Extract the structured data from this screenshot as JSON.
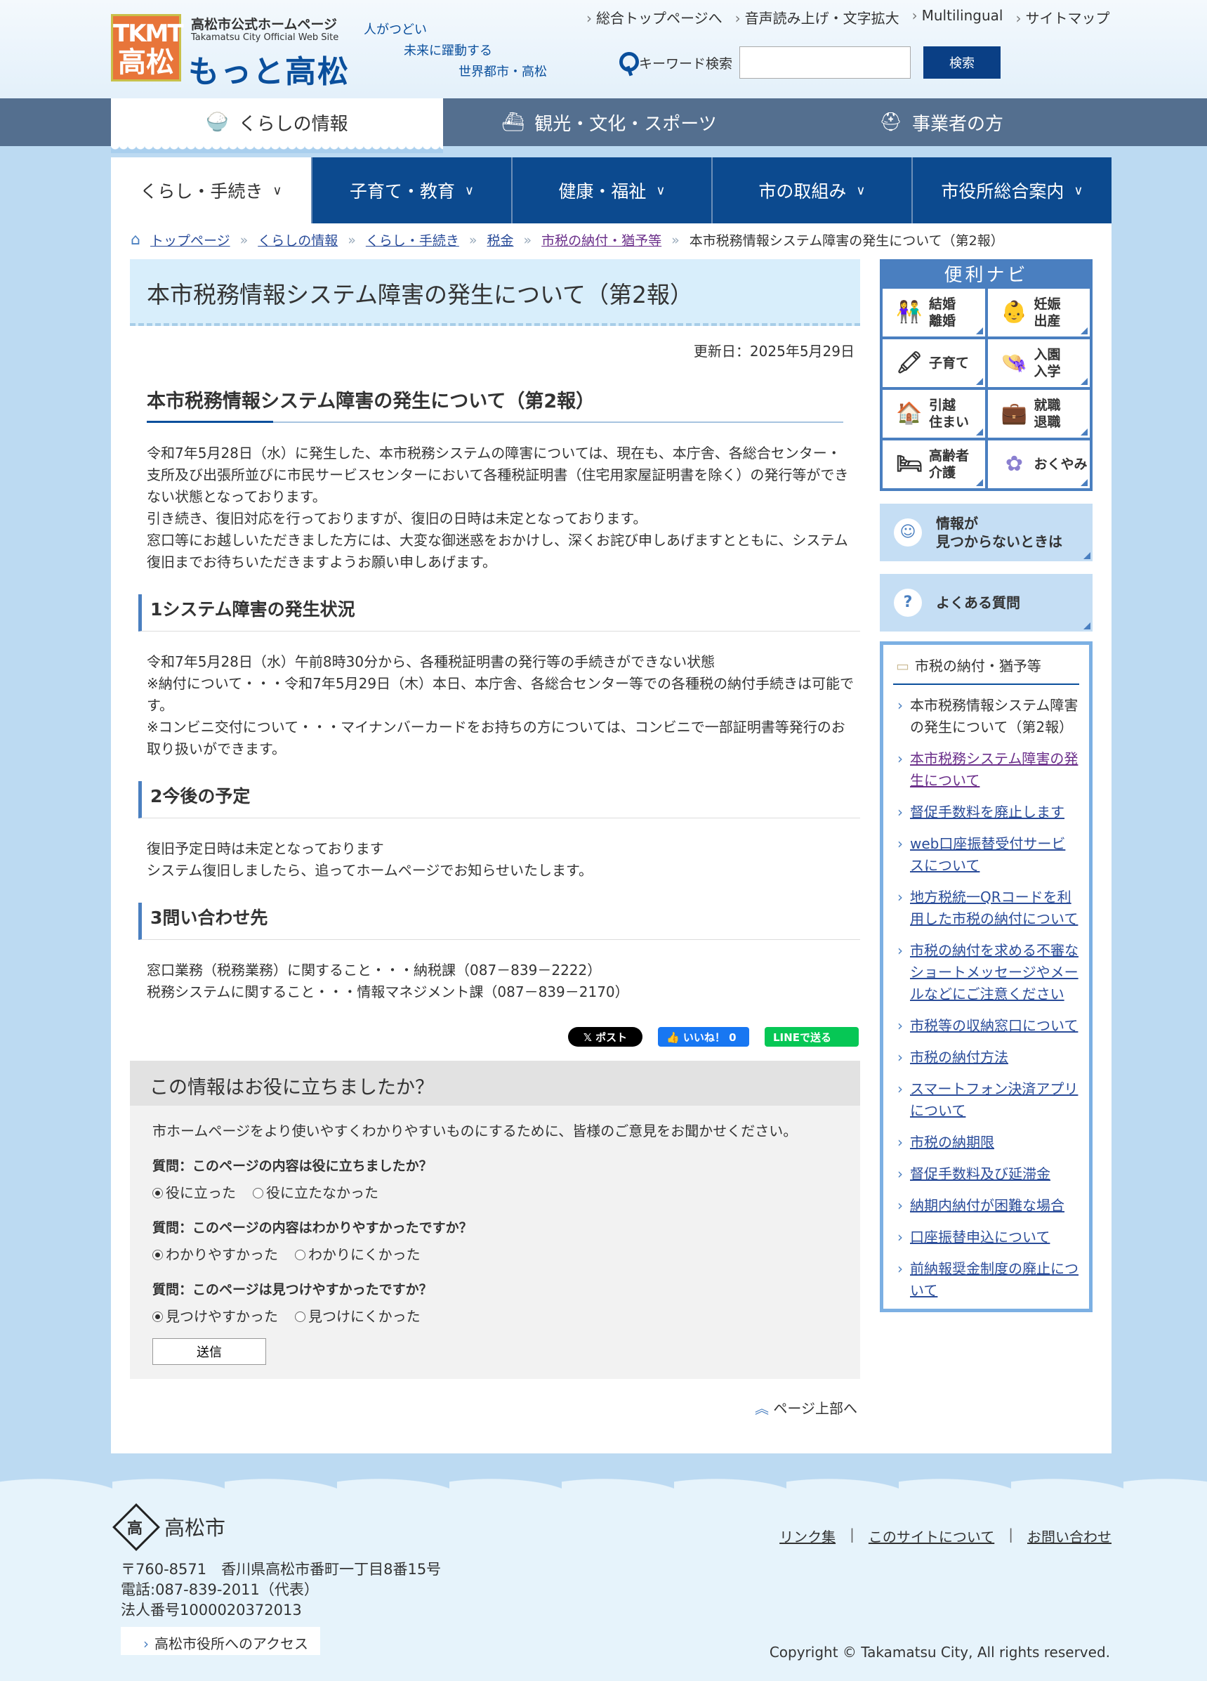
{
  "header": {
    "logo_top": "TKMT",
    "logo_bottom": "高松",
    "site_sub": "高松市公式ホームページ",
    "site_en": "Takamatsu City Official Web Site",
    "site_name": "もっと高松",
    "slogan": [
      "人がつどい",
      "未来に躍動する",
      "世界都市・高松"
    ],
    "util_links": [
      "総合トップページへ",
      "音声読み上げ・文字拡大",
      "Multilingual",
      "サイトマップ"
    ],
    "search_label": "キーワード検索",
    "search_value": "",
    "search_button": "検索"
  },
  "tabs": [
    {
      "label": "くらしの情報",
      "icon": "bowl-icon",
      "glyph": "🍚"
    },
    {
      "label": "観光・文化・スポーツ",
      "icon": "ship-icon",
      "glyph": "⛴"
    },
    {
      "label": "事業者の方",
      "icon": "worker-icon",
      "glyph": "⛑"
    }
  ],
  "gnav": [
    "くらし・手続き",
    "子育て・教育",
    "健康・福祉",
    "市の取組み",
    "市役所総合案内"
  ],
  "breadcrumb": [
    "トップページ",
    "くらしの情報",
    "くらし・手続き",
    "税金",
    "市税の納付・猶予等",
    "本市税務情報システム障害の発生について（第2報）"
  ],
  "main": {
    "page_title": "本市税務情報システム障害の発生について（第2報）",
    "updated": "更新日：2025年5月29日",
    "h2": "本市税務情報システム障害の発生について（第2報）",
    "intro": [
      "令和7年5月28日（水）に発生した、本市税務システムの障害については、現在も、本庁舎、各総合センター・支所及び出張所並びに市民サービスセンターにおいて各種税証明書（住宅用家屋証明書を除く）の発行等ができない状態となっております。",
      "引き続き、復旧対応を行っておりますが、復旧の日時は未定となっております。",
      "窓口等にお越しいただきました方には、大変な御迷惑をおかけし、深くお詫び申しあげますとともに、システム復旧までお待ちいただきますようお願い申しあげます。"
    ],
    "sections": [
      {
        "title": "1システム障害の発生状況",
        "lines": [
          "令和7年5月28日（水）午前8時30分から、各種税証明書の発行等の手続きができない状態",
          "※納付について・・・令和7年5月29日（木）本日、本庁舎、各総合センター等での各種税の納付手続きは可能です。",
          "※コンビニ交付について・・・マイナンバーカードをお持ちの方については、コンビニで一部証明書等発行のお取り扱いができます。"
        ]
      },
      {
        "title": "2今後の予定",
        "lines": [
          "復旧予定日時は未定となっております",
          "システム復旧しましたら、追ってホームページでお知らせいたします。"
        ]
      },
      {
        "title": "3問い合わせ先",
        "lines": [
          "窓口業務（税務業務）に関すること・・・納税課（087－839－2222）",
          "税務システムに関すること・・・情報マネジメント課（087－839－2170）"
        ]
      }
    ],
    "share": {
      "x": "𝕏 ポスト",
      "like": "👍 いいね！ 0",
      "line": "LINEで送る"
    },
    "pagetop": "ページ上部へ"
  },
  "survey": {
    "title": "この情報はお役に立ちましたか？",
    "intro": "市ホームページをより使いやすくわかりやすいものにするために、皆様のご意見をお聞かせください。",
    "questions": [
      {
        "q": "質問：このページの内容は役に立ちましたか？",
        "a": "役に立った",
        "b": "役に立たなかった"
      },
      {
        "q": "質問：このページの内容はわかりやすかったですか？",
        "a": "わかりやすかった",
        "b": "わかりにくかった"
      },
      {
        "q": "質問：このページは見つけやすかったですか？",
        "a": "見つけやすかった",
        "b": "見つけにくかった"
      }
    ],
    "submit": "送信"
  },
  "sidebar": {
    "navi_title": "便利ナビ",
    "navi_items": [
      {
        "label": "結婚\n離婚",
        "icon": "couple-icon",
        "glyph": "👫"
      },
      {
        "label": "妊娠\n出産",
        "icon": "baby-icon",
        "glyph": "👶"
      },
      {
        "label": "子育て",
        "icon": "crayon-icon",
        "glyph": "🖍"
      },
      {
        "label": "入園\n入学",
        "icon": "hat-icon",
        "glyph": "👒"
      },
      {
        "label": "引越\n住まい",
        "icon": "house-icon",
        "glyph": "🏠"
      },
      {
        "label": "就職\n退職",
        "icon": "briefcase-icon",
        "glyph": "💼"
      },
      {
        "label": "高齢者\n介護",
        "icon": "bed-icon",
        "glyph": "🛏"
      },
      {
        "label": "おくやみ",
        "icon": "flower-icon",
        "glyph": "✿"
      }
    ],
    "help": "情報が\n見つからないときは",
    "faq": "よくある質問",
    "rel_title": "市税の納付・猶予等",
    "rel_items": [
      "本市税務情報システム障害の発生について（第2報）",
      "本市税務システム障害の発生について",
      "督促手数料を廃止します",
      "web口座振替受付サービスについて",
      "地方税統一QRコードを利用した市税の納付について",
      "市税の納付を求める不審なショートメッセージやメールなどにご注意ください",
      "市税等の収納窓口について",
      "市税の納付方法",
      "スマートフォン決済アプリについて",
      "市税の納期限",
      "督促手数料及び延滞金",
      "納期内納付が困難な場合",
      "口座振替申込について",
      "前納報奨金制度の廃止について"
    ]
  },
  "footer": {
    "name": "高松市",
    "address": "〒760-8571　香川県高松市番町一丁目8番15号",
    "tel": "電話:087-839-2011（代表）",
    "corp": "法人番号1000020372013",
    "links": [
      "リンク集",
      "このサイトについて",
      "お問い合わせ"
    ],
    "access": "高松市役所へのアクセス",
    "copyright": "Copyright © Takamatsu City, All rights reserved."
  },
  "colors": {
    "primary": "#0c4a8f",
    "accent": "#4a7fc0",
    "bg": "#bcdaf2"
  }
}
